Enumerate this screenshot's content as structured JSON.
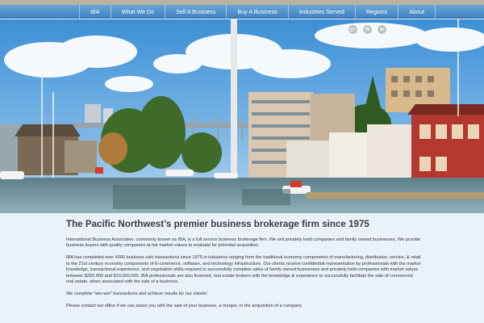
{
  "nav": {
    "items": [
      "IBA",
      "What We Do",
      "Sell A Business",
      "Buy A Business",
      "Industries Served",
      "Regions",
      "About"
    ]
  },
  "social": {
    "icons": [
      {
        "name": "google-plus-icon",
        "glyph": "g+"
      },
      {
        "name": "wordpress-icon",
        "glyph": "W"
      },
      {
        "name": "linkedin-icon",
        "glyph": "in"
      }
    ]
  },
  "hero": {
    "description_icon": "houseboat-marina-photo"
  },
  "content": {
    "heading": "The Pacific Northwest’s premier business brokerage firm since 1975",
    "paragraphs": [
      "International Business Associates, commonly known as IBA, is a full service  business brokerage firm. We sell privately held companies and family owned businesses. We provide business buyers with quality companies at fair market values to evaluate for potential acquisition.",
      "IBA has completed over 4000 business sale transactions since 1975 in industries ranging from the traditional economy components of manufacturing, distribution, service, & retail to the 21st century economy components of E-commerce, software, and technology infrastructure.  Our clients receive confidential representation by professionals with the market knowledge, transactional experience, and negotiation skills required to successfully complete sales of family owned businesses and privately held companies with market values between $250,000 and $10,000,000.   IBA professionals are also licensed, real estate brokers with the knowledge & experience to successfully facilitate the  sale of commercial real estate, when associated with the sale of a business.",
      "We complete \"win-win\" transactions and achieve results for our clients!",
      "Please contact our office if we can assist you with the sale of your business, a merger, or the acquisition of a company."
    ]
  },
  "colors": {
    "nav_top": "#6aa6d8",
    "nav_bottom": "#3f82c2",
    "page_bg": "#eaf1f9",
    "text": "#333333"
  }
}
